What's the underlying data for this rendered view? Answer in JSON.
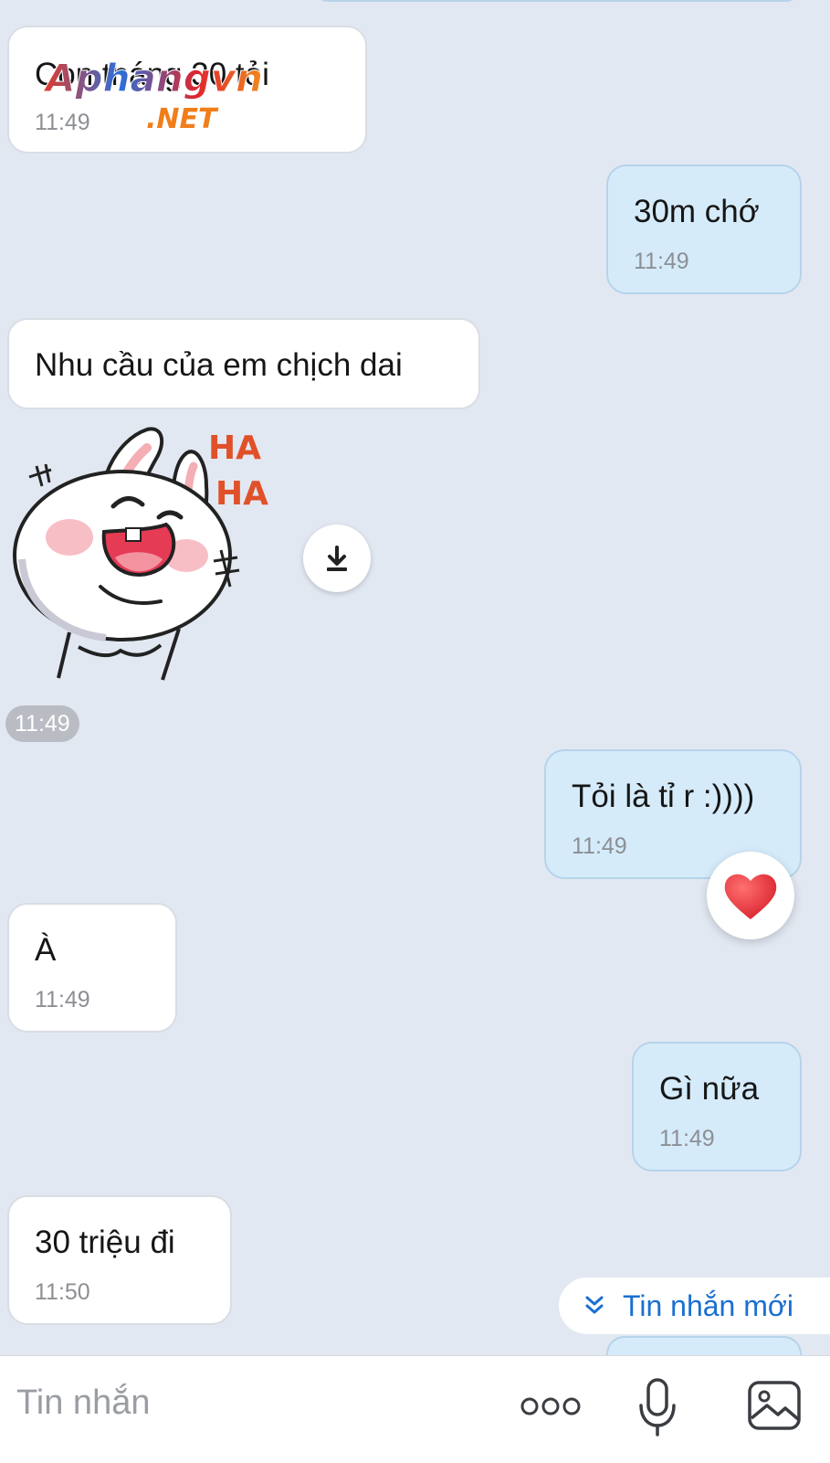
{
  "watermark": {
    "brand": "Aphangvn",
    "suffix": ".NET"
  },
  "messages": [
    {
      "text": "Con tháng 30 tỏi",
      "time": "11:49",
      "dir": "in"
    },
    {
      "text": "30m chớ",
      "time": "11:49",
      "dir": "out"
    },
    {
      "text": "Nhu cầu của em chịch dai",
      "dir": "in"
    },
    {
      "sticker": "bunny-laughing",
      "sticker_text": [
        "HA",
        "HA"
      ],
      "time": "11:49",
      "dir": "in"
    },
    {
      "text": "Tỏi là tỉ r :))))",
      "time": "11:49",
      "dir": "out",
      "reaction": "heart-icon"
    },
    {
      "text": "À",
      "time": "11:49",
      "dir": "in"
    },
    {
      "text": "Gì nữa",
      "time": "11:49",
      "dir": "out"
    },
    {
      "text": "30 triệu đi",
      "time": "11:50",
      "dir": "in"
    }
  ],
  "new_messages": {
    "label": "Tin nhắn mới",
    "icon": "double-chevron-down-icon"
  },
  "composer": {
    "placeholder": "Tin nhắn",
    "icons": [
      "more-icon",
      "microphone-icon",
      "image-icon"
    ]
  },
  "colors": {
    "background": "#e2e8f2",
    "incoming": "#ffffff",
    "outgoing": "#d5ebfa",
    "accent": "#1a6fd1",
    "heart": "#e53935"
  }
}
